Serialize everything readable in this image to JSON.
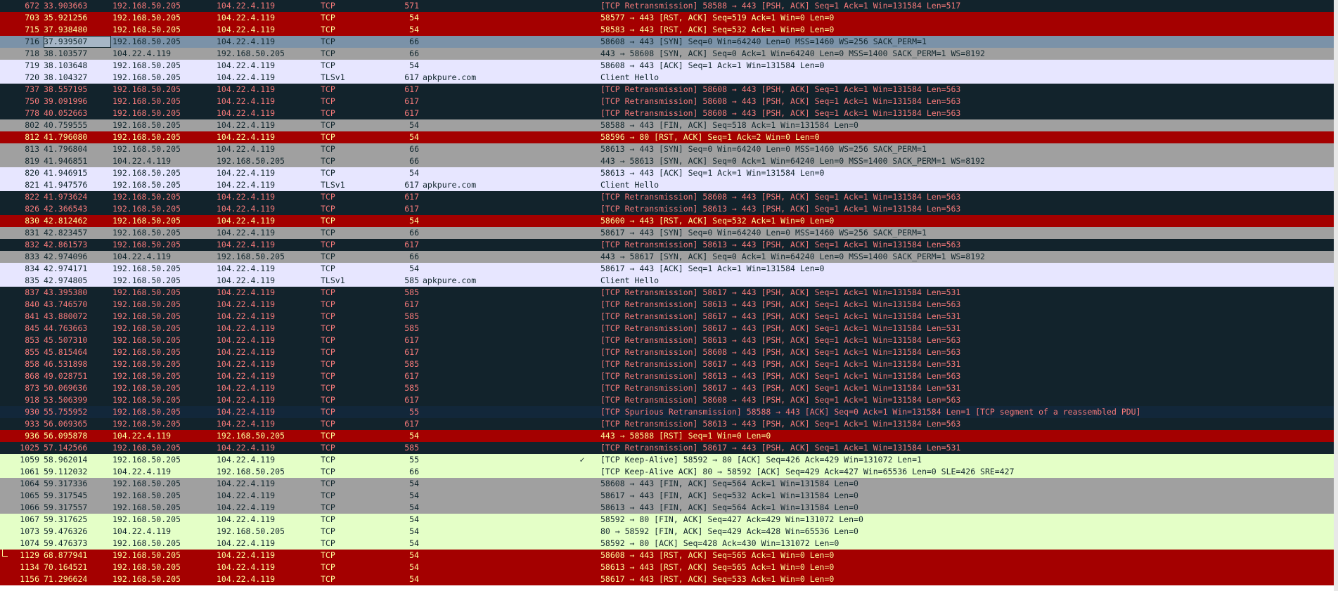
{
  "colors": {
    "dark": "#12232c",
    "red": "#a40000",
    "gray": "#a0a0a0",
    "lavender": "#e7e6ff",
    "green": "#e4ffc7",
    "navy": "#12273a",
    "selected": "#7b92a8"
  },
  "packets": [
    {
      "no": "672",
      "time": "33.903663",
      "src": "192.168.50.205",
      "dst": "104.22.4.119",
      "proto": "TCP",
      "len": "571",
      "host": "",
      "mark": "",
      "info": "[TCP Retransmission] 58588 → 443 [PSH, ACK] Seq=1 Ack=1 Win=131584 Len=517",
      "style": "dark"
    },
    {
      "no": "703",
      "time": "35.921256",
      "src": "192.168.50.205",
      "dst": "104.22.4.119",
      "proto": "TCP",
      "len": "54",
      "host": "",
      "mark": "",
      "info": "58577 → 443 [RST, ACK] Seq=519 Ack=1 Win=0 Len=0",
      "style": "red"
    },
    {
      "no": "715",
      "time": "37.938480",
      "src": "192.168.50.205",
      "dst": "104.22.4.119",
      "proto": "TCP",
      "len": "54",
      "host": "",
      "mark": "",
      "info": "58583 → 443 [RST, ACK] Seq=532 Ack=1 Win=0 Len=0",
      "style": "red"
    },
    {
      "no": "716",
      "time": "37.939507",
      "src": "192.168.50.205",
      "dst": "104.22.4.119",
      "proto": "TCP",
      "len": "66",
      "host": "",
      "mark": "",
      "info": "58608 → 443 [SYN] Seq=0 Win=64240 Len=0 MSS=1460 WS=256 SACK_PERM=1",
      "style": "sel"
    },
    {
      "no": "718",
      "time": "38.103577",
      "src": "104.22.4.119",
      "dst": "192.168.50.205",
      "proto": "TCP",
      "len": "66",
      "host": "",
      "mark": "",
      "info": "443 → 58608 [SYN, ACK] Seq=0 Ack=1 Win=64240 Len=0 MSS=1400 SACK_PERM=1 WS=8192",
      "style": "gray"
    },
    {
      "no": "719",
      "time": "38.103648",
      "src": "192.168.50.205",
      "dst": "104.22.4.119",
      "proto": "TCP",
      "len": "54",
      "host": "",
      "mark": "",
      "info": "58608 → 443 [ACK] Seq=1 Ack=1 Win=131584 Len=0",
      "style": "lav"
    },
    {
      "no": "720",
      "time": "38.104327",
      "src": "192.168.50.205",
      "dst": "104.22.4.119",
      "proto": "TLSv1",
      "len": "617",
      "host": "apkpure.com",
      "mark": "",
      "info": "Client Hello",
      "style": "lav"
    },
    {
      "no": "737",
      "time": "38.557195",
      "src": "192.168.50.205",
      "dst": "104.22.4.119",
      "proto": "TCP",
      "len": "617",
      "host": "",
      "mark": "",
      "info": "[TCP Retransmission] 58608 → 443 [PSH, ACK] Seq=1 Ack=1 Win=131584 Len=563",
      "style": "dark"
    },
    {
      "no": "750",
      "time": "39.091996",
      "src": "192.168.50.205",
      "dst": "104.22.4.119",
      "proto": "TCP",
      "len": "617",
      "host": "",
      "mark": "",
      "info": "[TCP Retransmission] 58608 → 443 [PSH, ACK] Seq=1 Ack=1 Win=131584 Len=563",
      "style": "dark"
    },
    {
      "no": "778",
      "time": "40.052663",
      "src": "192.168.50.205",
      "dst": "104.22.4.119",
      "proto": "TCP",
      "len": "617",
      "host": "",
      "mark": "",
      "info": "[TCP Retransmission] 58608 → 443 [PSH, ACK] Seq=1 Ack=1 Win=131584 Len=563",
      "style": "dark"
    },
    {
      "no": "802",
      "time": "40.759555",
      "src": "192.168.50.205",
      "dst": "104.22.4.119",
      "proto": "TCP",
      "len": "54",
      "host": "",
      "mark": "",
      "info": "58588 → 443 [FIN, ACK] Seq=518 Ack=1 Win=131584 Len=0",
      "style": "gray"
    },
    {
      "no": "812",
      "time": "41.796080",
      "src": "192.168.50.205",
      "dst": "104.22.4.119",
      "proto": "TCP",
      "len": "54",
      "host": "",
      "mark": "",
      "info": "58596 → 80 [RST, ACK] Seq=1 Ack=2 Win=0 Len=0",
      "style": "red"
    },
    {
      "no": "813",
      "time": "41.796804",
      "src": "192.168.50.205",
      "dst": "104.22.4.119",
      "proto": "TCP",
      "len": "66",
      "host": "",
      "mark": "",
      "info": "58613 → 443 [SYN] Seq=0 Win=64240 Len=0 MSS=1460 WS=256 SACK_PERM=1",
      "style": "gray"
    },
    {
      "no": "819",
      "time": "41.946851",
      "src": "104.22.4.119",
      "dst": "192.168.50.205",
      "proto": "TCP",
      "len": "66",
      "host": "",
      "mark": "",
      "info": "443 → 58613 [SYN, ACK] Seq=0 Ack=1 Win=64240 Len=0 MSS=1400 SACK_PERM=1 WS=8192",
      "style": "gray"
    },
    {
      "no": "820",
      "time": "41.946915",
      "src": "192.168.50.205",
      "dst": "104.22.4.119",
      "proto": "TCP",
      "len": "54",
      "host": "",
      "mark": "",
      "info": "58613 → 443 [ACK] Seq=1 Ack=1 Win=131584 Len=0",
      "style": "lav"
    },
    {
      "no": "821",
      "time": "41.947576",
      "src": "192.168.50.205",
      "dst": "104.22.4.119",
      "proto": "TLSv1",
      "len": "617",
      "host": "apkpure.com",
      "mark": "",
      "info": "Client Hello",
      "style": "lav"
    },
    {
      "no": "822",
      "time": "41.973624",
      "src": "192.168.50.205",
      "dst": "104.22.4.119",
      "proto": "TCP",
      "len": "617",
      "host": "",
      "mark": "",
      "info": "[TCP Retransmission] 58608 → 443 [PSH, ACK] Seq=1 Ack=1 Win=131584 Len=563",
      "style": "dark"
    },
    {
      "no": "826",
      "time": "42.366543",
      "src": "192.168.50.205",
      "dst": "104.22.4.119",
      "proto": "TCP",
      "len": "617",
      "host": "",
      "mark": "",
      "info": "[TCP Retransmission] 58613 → 443 [PSH, ACK] Seq=1 Ack=1 Win=131584 Len=563",
      "style": "dark"
    },
    {
      "no": "830",
      "time": "42.812462",
      "src": "192.168.50.205",
      "dst": "104.22.4.119",
      "proto": "TCP",
      "len": "54",
      "host": "",
      "mark": "",
      "info": "58600 → 443 [RST, ACK] Seq=532 Ack=1 Win=0 Len=0",
      "style": "red"
    },
    {
      "no": "831",
      "time": "42.823457",
      "src": "192.168.50.205",
      "dst": "104.22.4.119",
      "proto": "TCP",
      "len": "66",
      "host": "",
      "mark": "",
      "info": "58617 → 443 [SYN] Seq=0 Win=64240 Len=0 MSS=1460 WS=256 SACK_PERM=1",
      "style": "gray"
    },
    {
      "no": "832",
      "time": "42.861573",
      "src": "192.168.50.205",
      "dst": "104.22.4.119",
      "proto": "TCP",
      "len": "617",
      "host": "",
      "mark": "",
      "info": "[TCP Retransmission] 58613 → 443 [PSH, ACK] Seq=1 Ack=1 Win=131584 Len=563",
      "style": "dark"
    },
    {
      "no": "833",
      "time": "42.974096",
      "src": "104.22.4.119",
      "dst": "192.168.50.205",
      "proto": "TCP",
      "len": "66",
      "host": "",
      "mark": "",
      "info": "443 → 58617 [SYN, ACK] Seq=0 Ack=1 Win=64240 Len=0 MSS=1400 SACK_PERM=1 WS=8192",
      "style": "gray"
    },
    {
      "no": "834",
      "time": "42.974171",
      "src": "192.168.50.205",
      "dst": "104.22.4.119",
      "proto": "TCP",
      "len": "54",
      "host": "",
      "mark": "",
      "info": "58617 → 443 [ACK] Seq=1 Ack=1 Win=131584 Len=0",
      "style": "lav"
    },
    {
      "no": "835",
      "time": "42.974805",
      "src": "192.168.50.205",
      "dst": "104.22.4.119",
      "proto": "TLSv1",
      "len": "585",
      "host": "apkpure.com",
      "mark": "",
      "info": "Client Hello",
      "style": "lav"
    },
    {
      "no": "837",
      "time": "43.395380",
      "src": "192.168.50.205",
      "dst": "104.22.4.119",
      "proto": "TCP",
      "len": "585",
      "host": "",
      "mark": "",
      "info": "[TCP Retransmission] 58617 → 443 [PSH, ACK] Seq=1 Ack=1 Win=131584 Len=531",
      "style": "dark"
    },
    {
      "no": "840",
      "time": "43.746570",
      "src": "192.168.50.205",
      "dst": "104.22.4.119",
      "proto": "TCP",
      "len": "617",
      "host": "",
      "mark": "",
      "info": "[TCP Retransmission] 58613 → 443 [PSH, ACK] Seq=1 Ack=1 Win=131584 Len=563",
      "style": "dark"
    },
    {
      "no": "841",
      "time": "43.880072",
      "src": "192.168.50.205",
      "dst": "104.22.4.119",
      "proto": "TCP",
      "len": "585",
      "host": "",
      "mark": "",
      "info": "[TCP Retransmission] 58617 → 443 [PSH, ACK] Seq=1 Ack=1 Win=131584 Len=531",
      "style": "dark"
    },
    {
      "no": "845",
      "time": "44.763663",
      "src": "192.168.50.205",
      "dst": "104.22.4.119",
      "proto": "TCP",
      "len": "585",
      "host": "",
      "mark": "",
      "info": "[TCP Retransmission] 58617 → 443 [PSH, ACK] Seq=1 Ack=1 Win=131584 Len=531",
      "style": "dark"
    },
    {
      "no": "853",
      "time": "45.507310",
      "src": "192.168.50.205",
      "dst": "104.22.4.119",
      "proto": "TCP",
      "len": "617",
      "host": "",
      "mark": "",
      "info": "[TCP Retransmission] 58613 → 443 [PSH, ACK] Seq=1 Ack=1 Win=131584 Len=563",
      "style": "dark"
    },
    {
      "no": "855",
      "time": "45.815464",
      "src": "192.168.50.205",
      "dst": "104.22.4.119",
      "proto": "TCP",
      "len": "617",
      "host": "",
      "mark": "",
      "info": "[TCP Retransmission] 58608 → 443 [PSH, ACK] Seq=1 Ack=1 Win=131584 Len=563",
      "style": "dark"
    },
    {
      "no": "858",
      "time": "46.531898",
      "src": "192.168.50.205",
      "dst": "104.22.4.119",
      "proto": "TCP",
      "len": "585",
      "host": "",
      "mark": "",
      "info": "[TCP Retransmission] 58617 → 443 [PSH, ACK] Seq=1 Ack=1 Win=131584 Len=531",
      "style": "dark"
    },
    {
      "no": "868",
      "time": "49.028751",
      "src": "192.168.50.205",
      "dst": "104.22.4.119",
      "proto": "TCP",
      "len": "617",
      "host": "",
      "mark": "",
      "info": "[TCP Retransmission] 58613 → 443 [PSH, ACK] Seq=1 Ack=1 Win=131584 Len=563",
      "style": "dark"
    },
    {
      "no": "873",
      "time": "50.069636",
      "src": "192.168.50.205",
      "dst": "104.22.4.119",
      "proto": "TCP",
      "len": "585",
      "host": "",
      "mark": "",
      "info": "[TCP Retransmission] 58617 → 443 [PSH, ACK] Seq=1 Ack=1 Win=131584 Len=531",
      "style": "dark"
    },
    {
      "no": "918",
      "time": "53.506399",
      "src": "192.168.50.205",
      "dst": "104.22.4.119",
      "proto": "TCP",
      "len": "617",
      "host": "",
      "mark": "",
      "info": "[TCP Retransmission] 58608 → 443 [PSH, ACK] Seq=1 Ack=1 Win=131584 Len=563",
      "style": "dark"
    },
    {
      "no": "930",
      "time": "55.755952",
      "src": "192.168.50.205",
      "dst": "104.22.4.119",
      "proto": "TCP",
      "len": "55",
      "host": "",
      "mark": "",
      "info": "[TCP Spurious Retransmission] 58588 → 443 [ACK] Seq=0 Ack=1 Win=131584 Len=1 [TCP segment of a reassembled PDU]",
      "style": "navy"
    },
    {
      "no": "933",
      "time": "56.069365",
      "src": "192.168.50.205",
      "dst": "104.22.4.119",
      "proto": "TCP",
      "len": "617",
      "host": "",
      "mark": "",
      "info": "[TCP Retransmission] 58613 → 443 [PSH, ACK] Seq=1 Ack=1 Win=131584 Len=563",
      "style": "dark"
    },
    {
      "no": "936",
      "time": "56.095878",
      "src": "104.22.4.119",
      "dst": "192.168.50.205",
      "proto": "TCP",
      "len": "54",
      "host": "",
      "mark": "",
      "info": "443 → 58588 [RST] Seq=1 Win=0 Len=0",
      "style": "red"
    },
    {
      "no": "1025",
      "time": "57.142566",
      "src": "192.168.50.205",
      "dst": "104.22.4.119",
      "proto": "TCP",
      "len": "585",
      "host": "",
      "mark": "",
      "info": "[TCP Retransmission] 58617 → 443 [PSH, ACK] Seq=1 Ack=1 Win=131584 Len=531",
      "style": "dark"
    },
    {
      "no": "1059",
      "time": "58.962014",
      "src": "192.168.50.205",
      "dst": "104.22.4.119",
      "proto": "TCP",
      "len": "55",
      "host": "",
      "mark": "✓",
      "info": "[TCP Keep-Alive] 58592 → 80 [ACK] Seq=426 Ack=429 Win=131072 Len=1",
      "style": "green"
    },
    {
      "no": "1061",
      "time": "59.112032",
      "src": "104.22.4.119",
      "dst": "192.168.50.205",
      "proto": "TCP",
      "len": "66",
      "host": "",
      "mark": "",
      "info": "[TCP Keep-Alive ACK] 80 → 58592 [ACK] Seq=429 Ack=427 Win=65536 Len=0 SLE=426 SRE=427",
      "style": "green"
    },
    {
      "no": "1064",
      "time": "59.317336",
      "src": "192.168.50.205",
      "dst": "104.22.4.119",
      "proto": "TCP",
      "len": "54",
      "host": "",
      "mark": "",
      "info": "58608 → 443 [FIN, ACK] Seq=564 Ack=1 Win=131584 Len=0",
      "style": "gray"
    },
    {
      "no": "1065",
      "time": "59.317545",
      "src": "192.168.50.205",
      "dst": "104.22.4.119",
      "proto": "TCP",
      "len": "54",
      "host": "",
      "mark": "",
      "info": "58617 → 443 [FIN, ACK] Seq=532 Ack=1 Win=131584 Len=0",
      "style": "gray"
    },
    {
      "no": "1066",
      "time": "59.317557",
      "src": "192.168.50.205",
      "dst": "104.22.4.119",
      "proto": "TCP",
      "len": "54",
      "host": "",
      "mark": "",
      "info": "58613 → 443 [FIN, ACK] Seq=564 Ack=1 Win=131584 Len=0",
      "style": "gray"
    },
    {
      "no": "1067",
      "time": "59.317625",
      "src": "192.168.50.205",
      "dst": "104.22.4.119",
      "proto": "TCP",
      "len": "54",
      "host": "",
      "mark": "",
      "info": "58592 → 80 [FIN, ACK] Seq=427 Ack=429 Win=131072 Len=0",
      "style": "green"
    },
    {
      "no": "1073",
      "time": "59.476326",
      "src": "104.22.4.119",
      "dst": "192.168.50.205",
      "proto": "TCP",
      "len": "54",
      "host": "",
      "mark": "",
      "info": "80 → 58592 [FIN, ACK] Seq=429 Ack=428 Win=65536 Len=0",
      "style": "green"
    },
    {
      "no": "1074",
      "time": "59.476373",
      "src": "192.168.50.205",
      "dst": "104.22.4.119",
      "proto": "TCP",
      "len": "54",
      "host": "",
      "mark": "",
      "info": "58592 → 80 [ACK] Seq=428 Ack=430 Win=131072 Len=0",
      "style": "green"
    },
    {
      "no": "1129",
      "time": "68.877941",
      "src": "192.168.50.205",
      "dst": "104.22.4.119",
      "proto": "TCP",
      "len": "54",
      "host": "",
      "mark": "",
      "info": "58608 → 443 [RST, ACK] Seq=565 Ack=1 Win=0 Len=0",
      "style": "red",
      "tree": true
    },
    {
      "no": "1134",
      "time": "70.164521",
      "src": "192.168.50.205",
      "dst": "104.22.4.119",
      "proto": "TCP",
      "len": "54",
      "host": "",
      "mark": "",
      "info": "58613 → 443 [RST, ACK] Seq=565 Ack=1 Win=0 Len=0",
      "style": "red"
    },
    {
      "no": "1156",
      "time": "71.296624",
      "src": "192.168.50.205",
      "dst": "104.22.4.119",
      "proto": "TCP",
      "len": "54",
      "host": "",
      "mark": "",
      "info": "58617 → 443 [RST, ACK] Seq=533 Ack=1 Win=0 Len=0",
      "style": "red"
    }
  ]
}
